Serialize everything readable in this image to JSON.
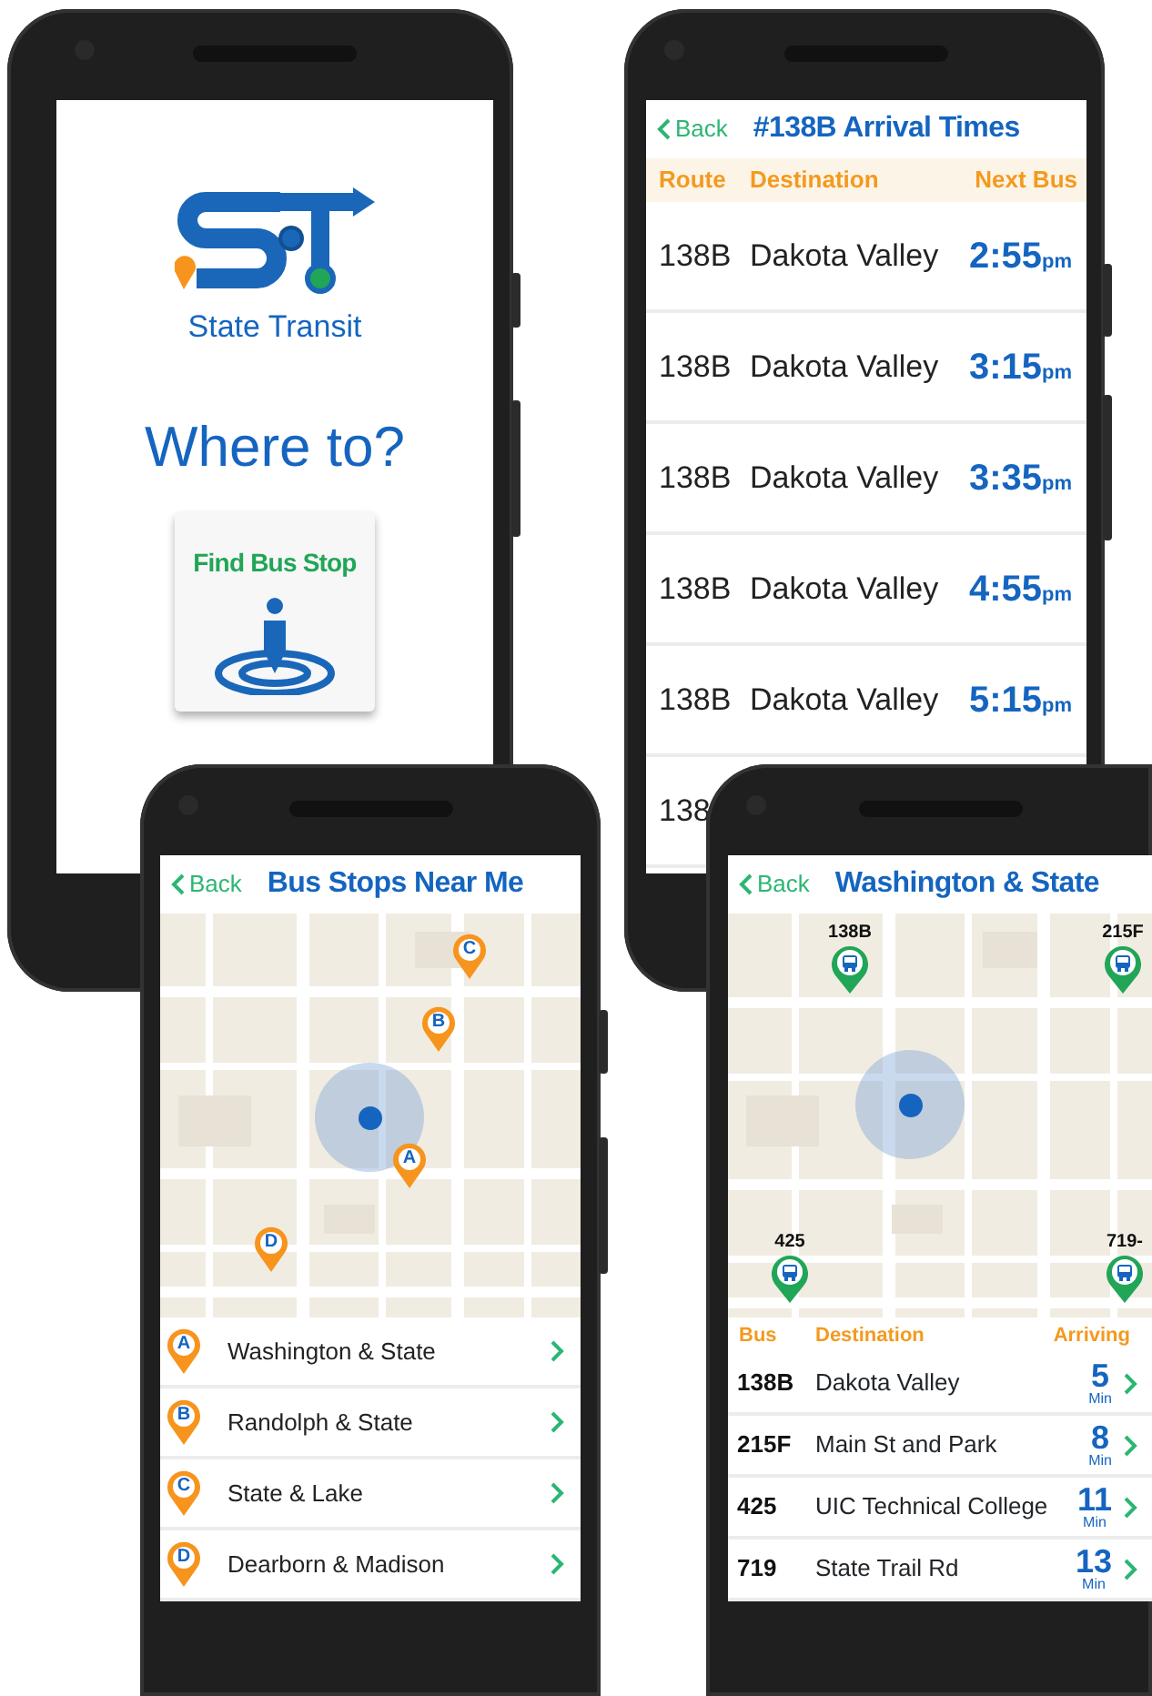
{
  "phones": [
    {
      "kind": "home",
      "brand": "State Transit",
      "heading": "Where to?",
      "action": "Find Bus Stop"
    },
    {
      "kind": "arrivals",
      "back": "Back",
      "title": "#138B Arrival Times",
      "columns": [
        "Route",
        "Destination",
        "Next Bus"
      ],
      "rows": [
        {
          "route": "138B",
          "destination": "Dakota Valley",
          "time": "2:55",
          "suffix": "pm"
        },
        {
          "route": "138B",
          "destination": "Dakota Valley",
          "time": "3:15",
          "suffix": "pm"
        },
        {
          "route": "138B",
          "destination": "Dakota Valley",
          "time": "3:35",
          "suffix": "pm"
        },
        {
          "route": "138B",
          "destination": "Dakota Valley",
          "time": "4:55",
          "suffix": "pm"
        },
        {
          "route": "138B",
          "destination": "Dakota Valley",
          "time": "5:15",
          "suffix": "pm"
        },
        {
          "route": "138"
        }
      ]
    },
    {
      "kind": "stops",
      "back": "Back",
      "title": "Bus Stops Near Me",
      "pins": [
        "C",
        "B",
        "A",
        "D"
      ],
      "stops": [
        {
          "marker": "A",
          "name": "Washington & State"
        },
        {
          "marker": "B",
          "name": "Randolph & State"
        },
        {
          "marker": "C",
          "name": "State & Lake"
        },
        {
          "marker": "D",
          "name": "Dearborn & Madison"
        }
      ]
    },
    {
      "kind": "station",
      "back": "Back",
      "title": "Washington & State",
      "buses": [
        "138B",
        "215F",
        "425",
        "719-"
      ],
      "columns": [
        "Bus",
        "Destination",
        "Arriving"
      ],
      "rows": [
        {
          "bus": "138B",
          "destination": "Dakota Valley",
          "minutes": "5",
          "unit": "Min"
        },
        {
          "bus": "215F",
          "destination": "Main St and Park",
          "minutes": "8",
          "unit": "Min"
        },
        {
          "bus": "425",
          "destination": "UIC Technical College",
          "minutes": "11",
          "unit": "Min"
        },
        {
          "bus": "719",
          "destination": "State Trail Rd",
          "minutes": "13",
          "unit": "Min"
        }
      ]
    }
  ]
}
